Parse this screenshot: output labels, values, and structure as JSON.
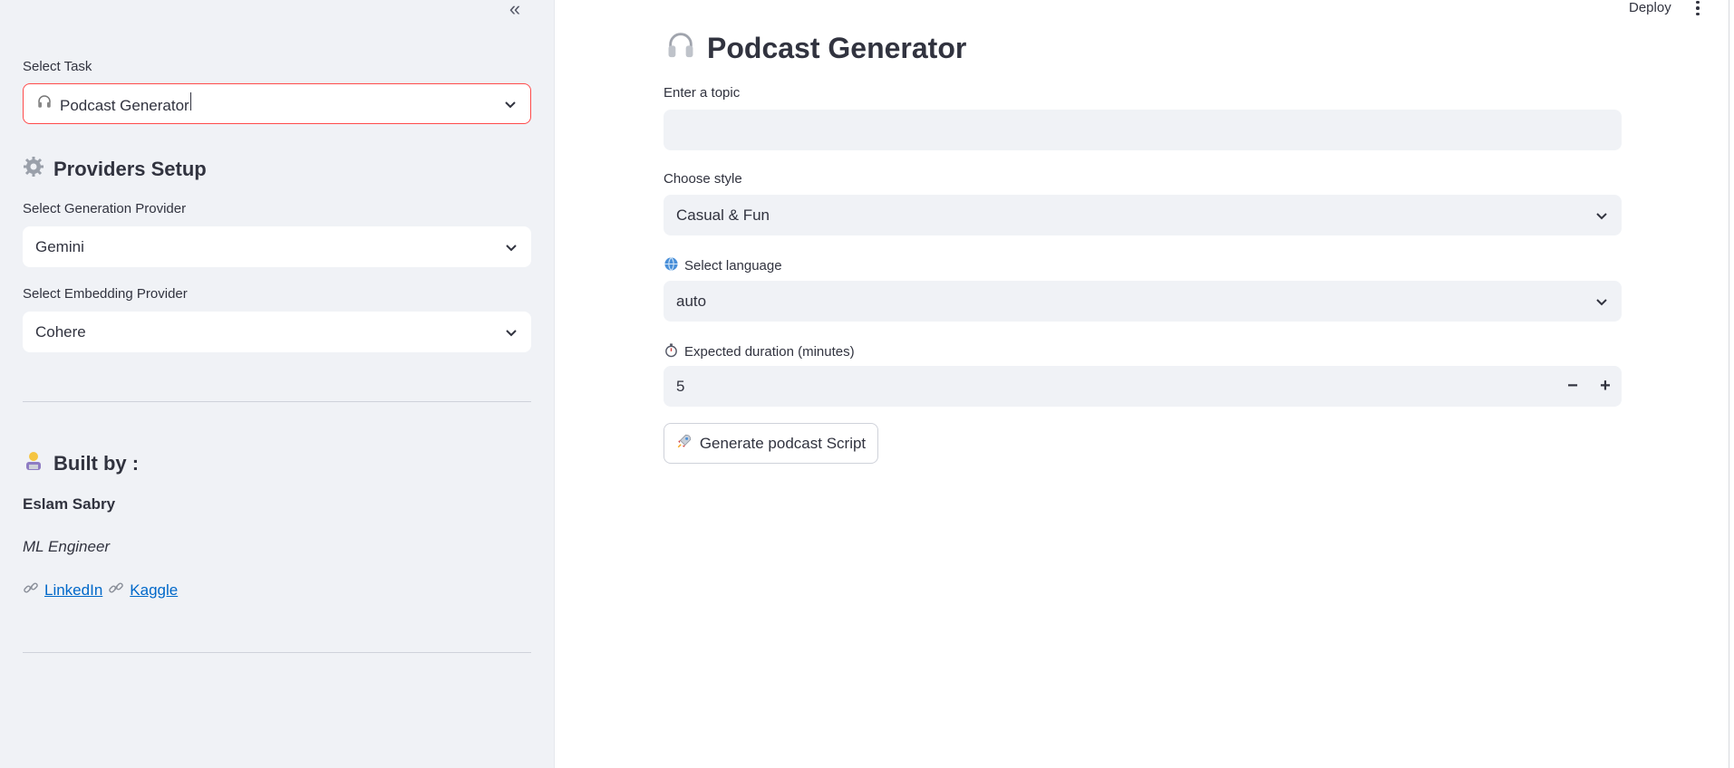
{
  "sidebar": {
    "select_task_label": "Select Task",
    "task_value": "Podcast Generator",
    "providers_heading": "Providers Setup",
    "generation_provider_label": "Select Generation Provider",
    "generation_provider_value": "Gemini",
    "embedding_provider_label": "Select Embedding Provider",
    "embedding_provider_value": "Cohere",
    "built_by_heading": "Built by :",
    "author_name": "Eslam Sabry",
    "author_role": "ML Engineer",
    "links": [
      "LinkedIn",
      "Kaggle"
    ]
  },
  "topbar": {
    "deploy_label": "Deploy"
  },
  "main": {
    "title": "Podcast Generator",
    "topic_label": "Enter a topic",
    "topic_value": "",
    "style_label": "Choose style",
    "style_value": "Casual & Fun",
    "language_label": "Select language",
    "language_value": "auto",
    "duration_label": "Expected duration (minutes)",
    "duration_value": "5",
    "generate_button_label": "Generate podcast Script"
  },
  "colors": {
    "accent_red": "#ff4b4b",
    "link_blue": "#0068c9",
    "sidebar_bg": "#f0f2f6",
    "text": "#31333f"
  },
  "icons": [
    "collapse-sidebar-icon",
    "headphones-icon",
    "gear-icon",
    "technologist-icon",
    "link-icon",
    "globe-icon",
    "stopwatch-icon",
    "rocket-icon",
    "chevron-down-icon",
    "kebab-menu-icon"
  ]
}
